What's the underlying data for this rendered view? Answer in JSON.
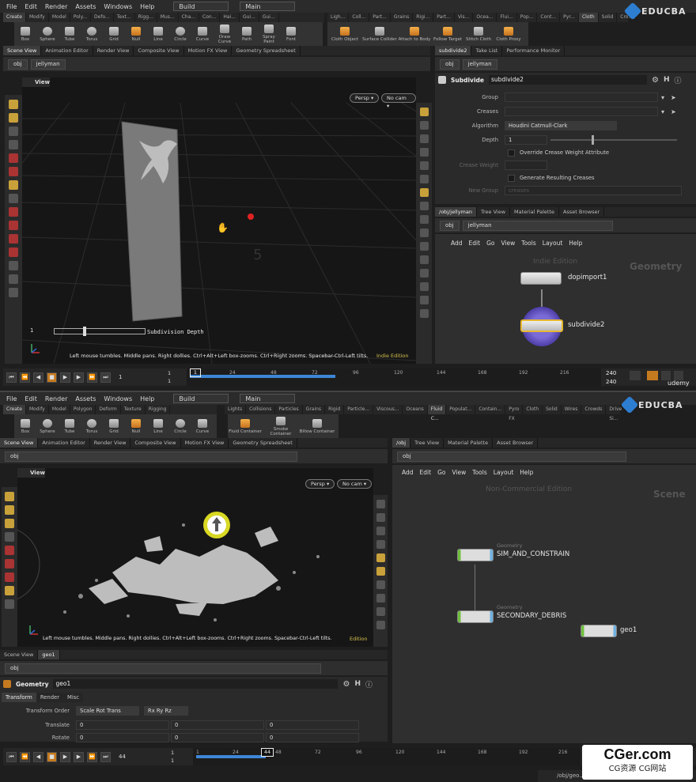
{
  "top": {
    "menu": [
      "File",
      "Edit",
      "Render",
      "Assets",
      "Windows",
      "Help"
    ],
    "desktop": "Build",
    "desktop2": "Main",
    "shelf_tabs_left": [
      "Create",
      "Modify",
      "Model",
      "Poly...",
      "Defo...",
      "Text...",
      "Rigg...",
      "Mus...",
      "Cha...",
      "Con...",
      "Hai...",
      "Gui...",
      "Gui..."
    ],
    "shelf_tabs_right": [
      "Ligh...",
      "Coll...",
      "Part...",
      "Grains",
      "Rigi...",
      "Part...",
      "Vis...",
      "Ocea...",
      "Flui...",
      "Pop...",
      "Cont...",
      "Pyr...",
      "Cloth",
      "Solid",
      "Cro..."
    ],
    "tools_left": [
      "Box",
      "Sphere",
      "Tube",
      "Torus",
      "Grid",
      "Null",
      "Line",
      "Circle",
      "Curve",
      "Draw Curve",
      "Path",
      "Spray Paint",
      "Font"
    ],
    "tools_right": [
      "Cloth Object",
      "Surface Collider",
      "Attach to Body",
      "Follow Target",
      "Stitch Cloth",
      "Cloth Proxy"
    ],
    "pane_tabs_left": [
      "Scene View",
      "Animation Editor",
      "Render View",
      "Composite View",
      "Motion FX View",
      "Geometry Spreadsheet"
    ],
    "pane_tabs_right": [
      "subdivide2",
      "Take List",
      "Performance Monitor"
    ],
    "path_left": [
      "obj",
      "jellyman"
    ],
    "path_right": [
      "obj",
      "jellyman"
    ],
    "viewport_title": "View",
    "persp": "Persp ▾",
    "cam": "No cam ▾",
    "slider_label": "Subdivision Depth",
    "slider_value": "1",
    "status": "Left mouse tumbles. Middle pans. Right dollies. Ctrl+Alt+Left box-zooms. Ctrl+Right zooms. Spacebar-Ctrl-Left tilts.",
    "edition": "Indie Edition",
    "params": {
      "node_type": "Subdivide",
      "node_name": "subdivide2",
      "group_label": "Group",
      "creases_label": "Creases",
      "algorithm_label": "Algorithm",
      "algorithm": "Houdini Catmull-Clark",
      "depth_label": "Depth",
      "depth": "1",
      "override": "Override Crease Weight Attribute",
      "crease_weight": "Crease Weight",
      "generate": "Generate Resulting Creases",
      "new_group": "New Group",
      "new_group_value": "creases"
    },
    "network_tabs": [
      "/obj/jellyman",
      "Tree View",
      "Material Palette",
      "Asset Browser"
    ],
    "network_path": [
      "obj",
      "jellyman"
    ],
    "network_menu": [
      "Add",
      "Edit",
      "Go",
      "View",
      "Tools",
      "Layout",
      "Help"
    ],
    "net_watermark": "Indie Edition",
    "net_context": "Geometry",
    "nodes": [
      "dopimport1",
      "subdivide2"
    ],
    "frame": "1",
    "frame_start": "1",
    "frame_end": "1",
    "end1": "240",
    "end2": "240",
    "ticks": [
      "24",
      "48",
      "72",
      "96",
      "120",
      "144",
      "168",
      "192",
      "216"
    ],
    "current_frame_marker": "1",
    "udemy": "udemy"
  },
  "bottom": {
    "menu": [
      "File",
      "Edit",
      "Render",
      "Assets",
      "Windows",
      "Help"
    ],
    "desktop": "Build",
    "desktop2": "Main",
    "shelf_tabs_left": [
      "Create",
      "Modify",
      "Model",
      "Polygon",
      "Deform",
      "Texture",
      "Rigging"
    ],
    "shelf_tabs_right": [
      "Lights a...",
      "Collisions",
      "Particles",
      "Grains",
      "Rigid B...",
      "Particle...",
      "Viscous...",
      "Oceans",
      "Fluid C...",
      "Populat...",
      "Contain...",
      "Pyro FX",
      "Cloth",
      "Solid",
      "Wires",
      "Crowds",
      "Drive Si..."
    ],
    "tools_left": [
      "Box",
      "Sphere",
      "Tube",
      "Torus",
      "Grid",
      "Null",
      "Line",
      "Circle",
      "Curve"
    ],
    "tools_right": [
      "Fluid Container",
      "Smoke Container",
      "Billow Container"
    ],
    "pane_tabs_left": [
      "Scene View",
      "Animation Editor",
      "Render View",
      "Composite View",
      "Motion FX View",
      "Geometry Spreadsheet"
    ],
    "pane_tabs_right": [
      "/obj",
      "Tree View",
      "Material Palette",
      "Asset Browser"
    ],
    "path_left": [
      "obj"
    ],
    "path_right": [
      "obj"
    ],
    "viewport_title": "View",
    "persp": "Persp ▾",
    "cam": "No cam ▾",
    "status": "Left mouse tumbles. Middle pans. Right dollies. Ctrl+Alt+Left box-zooms. Ctrl+Right zooms. Spacebar-Ctrl-Left tilts.",
    "edition": "Edition",
    "param_tabs": [
      "Scene View",
      "geo1"
    ],
    "param_path": "obj",
    "node_type": "Geometry",
    "node_name": "geo1",
    "sub_tabs": [
      "Transform",
      "Render",
      "Misc"
    ],
    "transform_order_label": "Transform Order",
    "transform_order": "Scale Rot Trans",
    "rot_order": "Rx Ry Rz",
    "translate_label": "Translate",
    "translate": [
      "0",
      "0",
      "0"
    ],
    "rotate_label": "Rotate",
    "rotate": [
      "0",
      "0",
      "0"
    ],
    "network_menu": [
      "Add",
      "Edit",
      "Go",
      "View",
      "Tools",
      "Layout",
      "Help"
    ],
    "net_watermark": "Non-Commercial Edition",
    "net_context": "Scene",
    "nodes": [
      {
        "type": "Geometry",
        "name": "SIM_AND_CONSTRAIN"
      },
      {
        "type": "Geometry",
        "name": "SECONDARY_DEBRIS"
      },
      {
        "type": "",
        "name": "geo1"
      }
    ],
    "frame": "44",
    "frame_start": "1",
    "frame_end": "1",
    "marker": "44",
    "ticks": [
      "1",
      "24",
      "48",
      "72",
      "96",
      "120",
      "144",
      "168",
      "192",
      "216"
    ],
    "bottom_path": "/obj/geo..."
  },
  "brand": {
    "educba": "EDUCBA",
    "cger": "CGer.com",
    "cger_sub": "CG资源 CG网站"
  },
  "colors": {
    "accent": "#c47a1f",
    "edition": "#d4c14b",
    "timebar": "#3d86d6"
  }
}
